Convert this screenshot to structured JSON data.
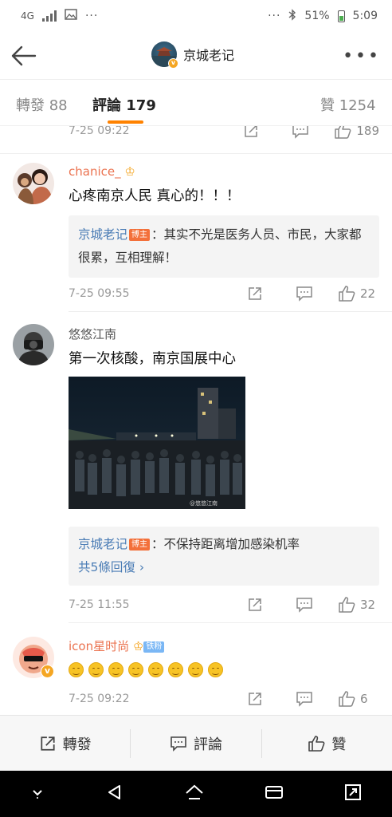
{
  "status": {
    "network": "4G",
    "battery": "51%",
    "time": "5:09"
  },
  "header": {
    "title": "京城老记"
  },
  "tabs": [
    {
      "label": "轉發",
      "count": "88"
    },
    {
      "label": "評論",
      "count": "179"
    },
    {
      "label": "贊",
      "count": "1254"
    }
  ],
  "comments": [
    {
      "time": "7-25 09:22",
      "likes": "189"
    },
    {
      "user": "chanice_",
      "text": "心疼南京人民 真心的！！！",
      "reply": {
        "author": "京城老记",
        "badge": "博主",
        "text": "：其实不光是医务人员、市民，大家都很累，互相理解！"
      },
      "time": "7-25 09:55",
      "likes": "22"
    },
    {
      "user": "悠悠江南",
      "text": "第一次核酸，南京国展中心",
      "photo_watermark": "@悠悠江南",
      "reply": {
        "author": "京城老记",
        "badge": "博主",
        "text": "：不保持距离增加感染机率"
      },
      "more_replies": "共5條回復",
      "time": "7-25 11:55",
      "likes": "32"
    },
    {
      "user": "icon星时尚",
      "badge": "铁粉",
      "emoji_count": 8,
      "time": "7-25 09:22",
      "likes": "6"
    }
  ],
  "bottom_bar": {
    "repost": "轉發",
    "comment": "評論",
    "like": "贊"
  },
  "colors": {
    "accent": "#ff8200",
    "username": "#eb7350",
    "link": "#4a7cb5"
  }
}
